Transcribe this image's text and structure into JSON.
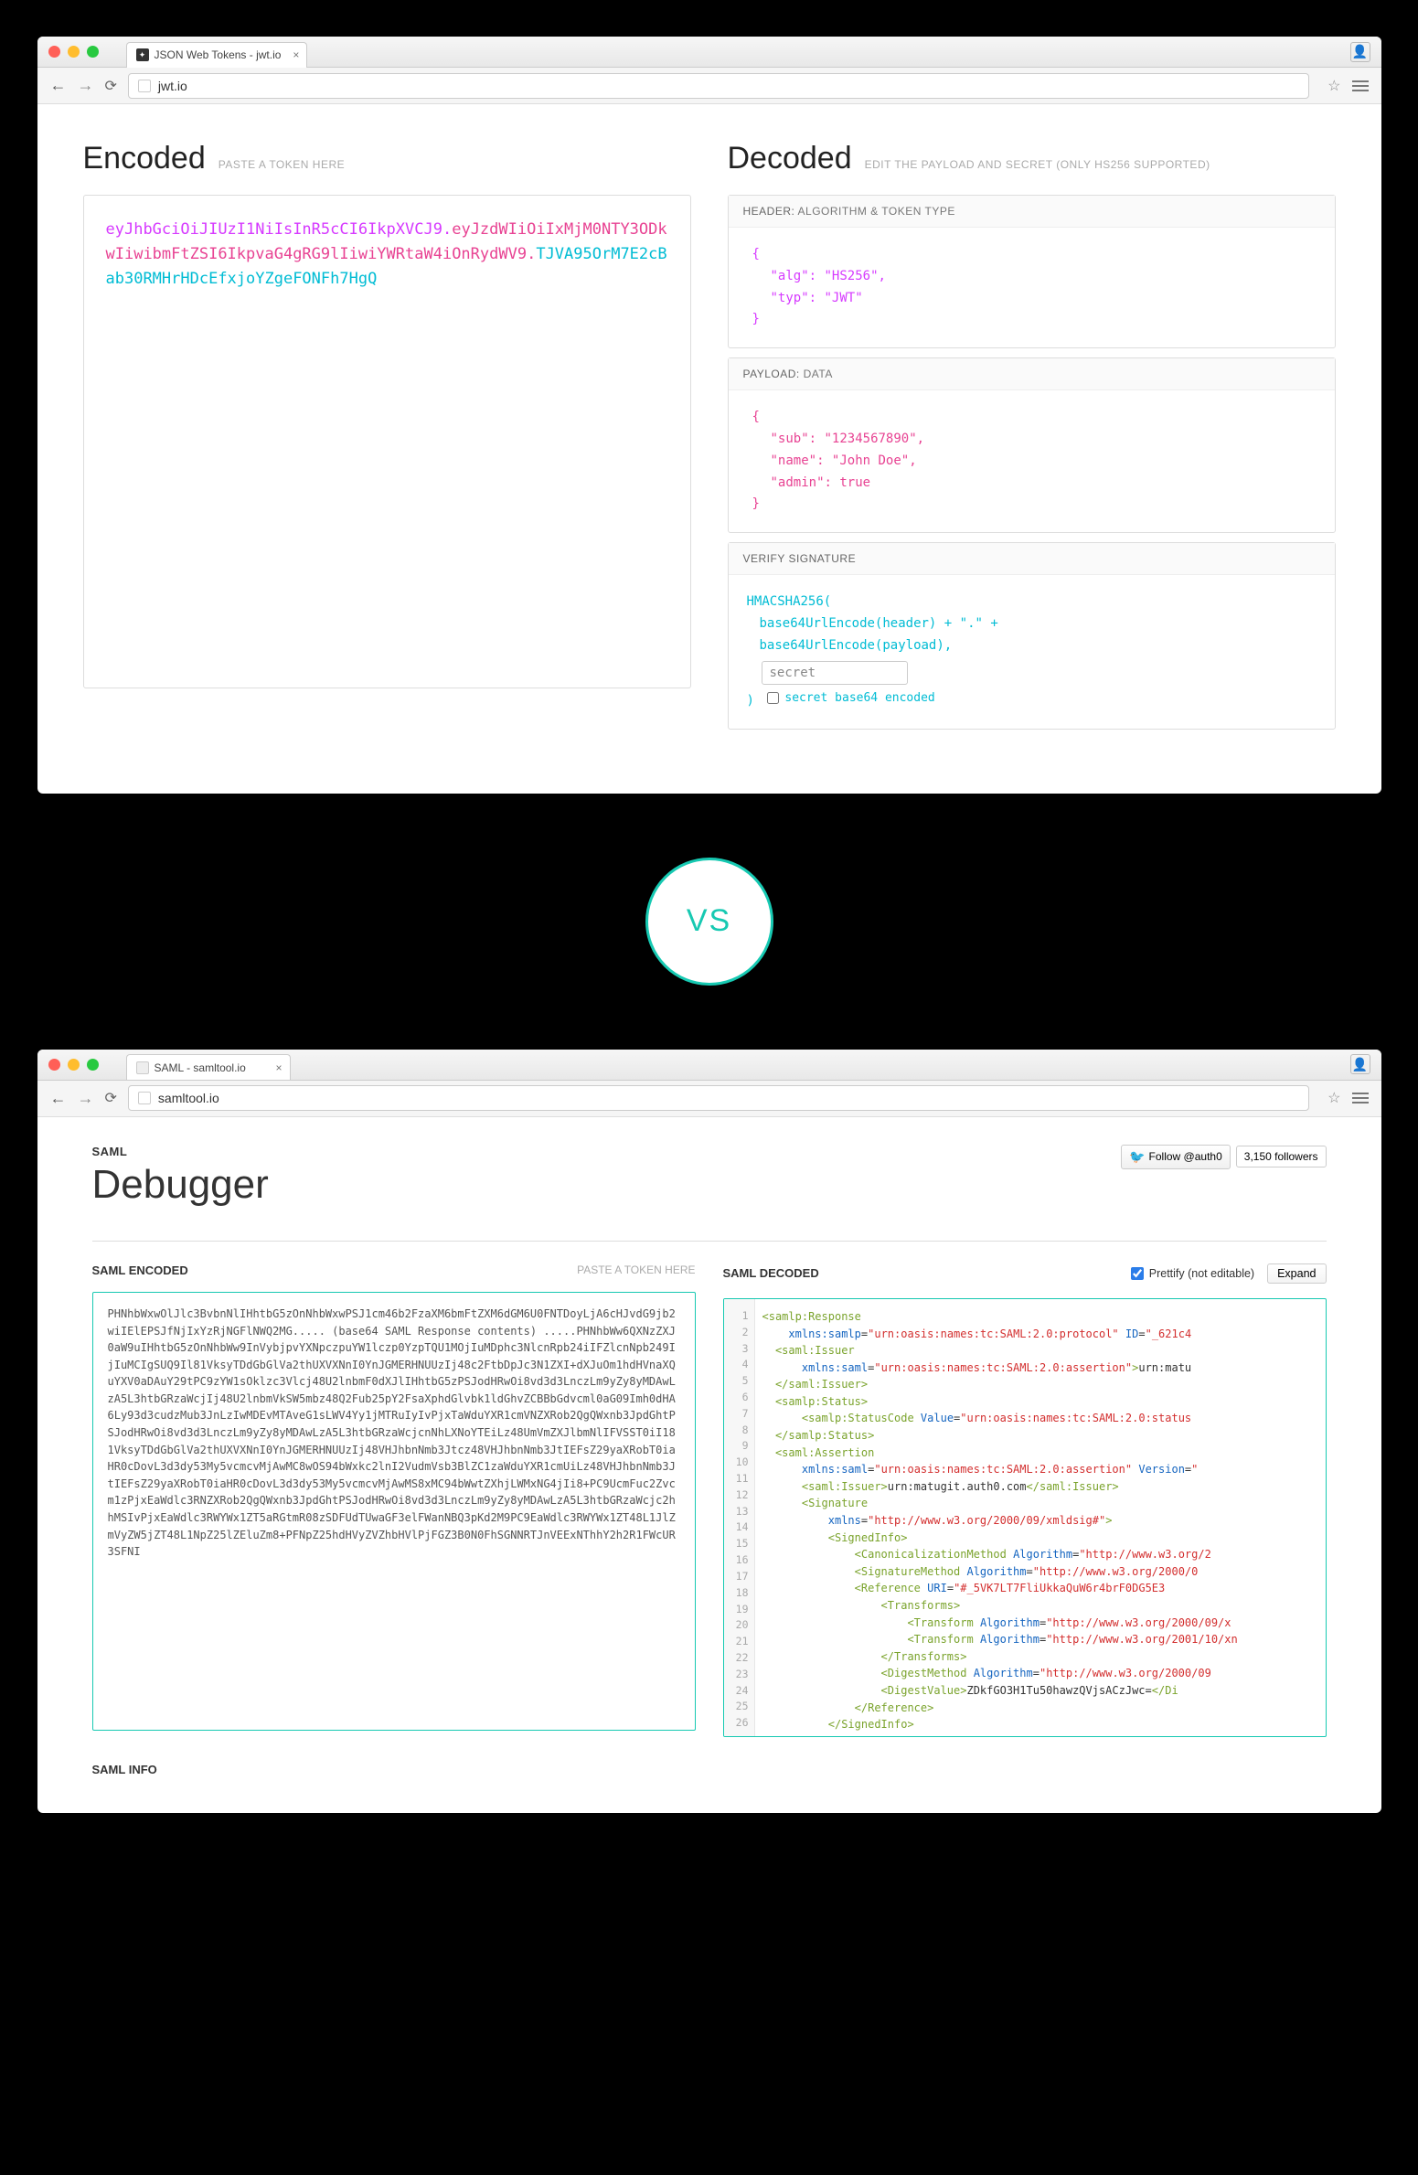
{
  "jwt": {
    "tab_title": "JSON Web Tokens - jwt.io",
    "url": "jwt.io",
    "encoded_title": "Encoded",
    "encoded_hint": "PASTE A TOKEN HERE",
    "decoded_title": "Decoded",
    "decoded_hint": "EDIT THE PAYLOAD AND SECRET (ONLY HS256 SUPPORTED)",
    "token_header": "eyJhbGciOiJIUzI1NiIsInR5cCI6IkpXVCJ9",
    "token_payload": "eyJzdWIiOiIxMjM0NTY3ODkwIiwibmFtZSI6IkpvaG4gRG9lIiwiYWRtaW4iOnRydWV9",
    "token_sig": "TJVA95OrM7E2cBab30RMHrHDcEfxjoYZgeFONFh7HgQ",
    "header_label": "HEADER:",
    "header_sub": "ALGORITHM & TOKEN TYPE",
    "header_json_l1": "{",
    "header_json_l2": "\"alg\": \"HS256\",",
    "header_json_l3": "\"typ\": \"JWT\"",
    "header_json_l4": "}",
    "payload_label": "PAYLOAD:",
    "payload_sub": "DATA",
    "payload_json_l1": "{",
    "payload_json_l2": "\"sub\": \"1234567890\",",
    "payload_json_l3": "\"name\": \"John Doe\",",
    "payload_json_l4": "\"admin\": true",
    "payload_json_l5": "}",
    "sig_label": "VERIFY SIGNATURE",
    "sig_l1": "HMACSHA256(",
    "sig_l2": "base64UrlEncode(header) + \".\" +",
    "sig_l3": "base64UrlEncode(payload),",
    "sig_secret": "secret",
    "sig_l4": ")",
    "sig_check": "secret base64 encoded"
  },
  "vs": "VS",
  "saml": {
    "tab_title": "SAML - samltool.io",
    "url": "samltool.io",
    "sup": "SAML",
    "title": "Debugger",
    "follow_label": "Follow @auth0",
    "follow_count": "3,150 followers",
    "enc_title": "SAML ENCODED",
    "enc_hint": "PASTE A TOKEN HERE",
    "dec_title": "SAML DECODED",
    "prettify": "Prettify (not editable)",
    "expand": "Expand",
    "enc_text": "PHNhbWxwOlJlc3BvbnNlIHhtbG5zOnNhbWxwPSJ1cm46b2FzaXM6bmFtZXM6dGM6U0FNTDoyLjA6cHJvdG9jb2wiIElEPSJfNjIxYzRjNGFlNWQ2MG..... (base64 SAML Response contents) .....PHNhbWw6QXNzZXJ0aW9uIHhtbG5zOnNhbWw9InVybjpvYXNpczpuYW1lczp0YzpTQU1MOjIuMDphc3NlcnRpb24iIFZlcnNpb249IjIuMCIgSUQ9Il81VksyTDdGbGlVa2thUXVXNnI0YnJGMERHNUUzIj48c2FtbDpJc3N1ZXI+dXJuOm1hdHVnaXQuYXV0aDAuY29tPC9zYW1sOklzc3Vlcj48U2lnbmF0dXJlIHhtbG5zPSJodHRwOi8vd3d3LnczLm9yZy8yMDAwLzA5L3htbGRzaWcjIj48U2lnbmVkSW5mbz48Q2Fub25pY2FsaXphdGlvbk1ldGhvZCBBbGdvcml0aG09Imh0dHA6Ly93d3cudzMub3JnLzIwMDEvMTAveG1sLWV4Yy1jMTRuIyIvPjxTaWduYXR1cmVNZXRob2QgQWxnb3JpdGhtPSJodHRwOi8vd3d3LnczLm9yZy8yMDAwLzA5L3htbGRzaWcjcnNhLXNoYTEiLz48UmVmZXJlbmNlIFVSST0iI181VksyTDdGbGlVa2thUXVXNnI0YnJGMERHNUUzIj48VHJhbnNmb3Jtcz48VHJhbnNmb3JtIEFsZ29yaXRobT0iaHR0cDovL3d3dy53My5vcmcvMjAwMC8wOS94bWxkc2lnI2VudmVsb3BlZC1zaWduYXR1cmUiLz48VHJhbnNmb3JtIEFsZ29yaXRobT0iaHR0cDovL3d3dy53My5vcmcvMjAwMS8xMC94bWwtZXhjLWMxNG4jIi8+PC9UcmFuc2Zvcm1zPjxEaWdlc3RNZXRob2QgQWxnb3JpdGhtPSJodHRwOi8vd3d3LnczLm9yZy8yMDAwLzA5L3htbGRzaWcjc2hhMSIvPjxEaWdlc3RWYWx1ZT5aRGtmR08zSDFUdTUwaGF3elFWanNBQ3pKd2M9PC9EaWdlc3RWYWx1ZT48L1JlZmVyZW5jZT48L1NpZ25lZEluZm8+PFNpZ25hdHVyZVZhbHVlPjFGZ3B0N0FhSGNNRTJnVEExNThhY2h2R1FWcUR3SFNI",
    "info": "SAML INFO"
  }
}
